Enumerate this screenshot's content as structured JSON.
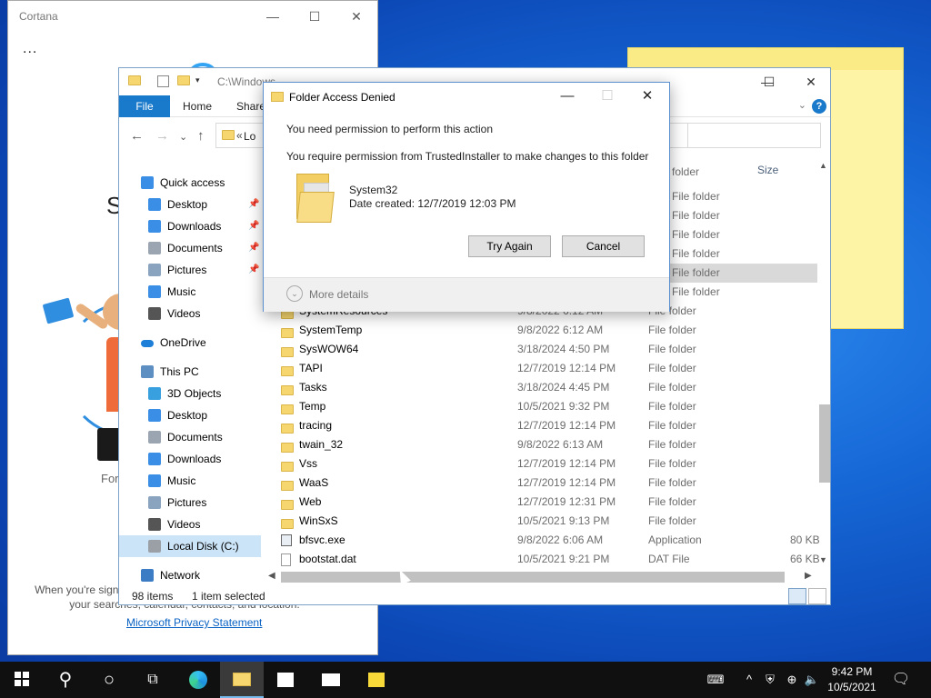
{
  "cortana": {
    "title": "Cortana",
    "ctrl_min": "—",
    "ctrl_max": "☐",
    "ctrl_close": "✕",
    "dots": "...",
    "big_s": "S",
    "for_text": "For",
    "fine_print": "When you're signed in, Cortana can use personal info such as your searches, calendar, contacts, and location.",
    "privacy_link": "Microsoft Privacy Statement"
  },
  "explorer": {
    "path": "C:\\Windows",
    "ctrl_min": "—",
    "ctrl_max": "☐",
    "ctrl_close": "✕",
    "ribbon": {
      "file": "File",
      "home": "Home",
      "share": "Share",
      "help": "?",
      "collapse": "⌄"
    },
    "nav": {
      "back": "←",
      "forward": "→",
      "recent": "⌄",
      "up": "↑"
    },
    "address": {
      "chevron": "«",
      "text": "Lo"
    },
    "nav_pane": [
      {
        "label": "Quick access",
        "icon": "star-icon",
        "level": 0
      },
      {
        "label": "Desktop",
        "icon": "desktop-icon",
        "level": 1,
        "pinned": true
      },
      {
        "label": "Downloads",
        "icon": "downloads-icon",
        "level": 1,
        "pinned": true
      },
      {
        "label": "Documents",
        "icon": "documents-icon",
        "level": 1,
        "pinned": true
      },
      {
        "label": "Pictures",
        "icon": "pictures-icon",
        "level": 1,
        "pinned": true
      },
      {
        "label": "Music",
        "icon": "music-icon",
        "level": 1
      },
      {
        "label": "Videos",
        "icon": "videos-icon",
        "level": 1
      },
      {
        "label": "OneDrive",
        "icon": "cloud-icon",
        "level": 0
      },
      {
        "label": "This PC",
        "icon": "pc-icon",
        "level": 0
      },
      {
        "label": "3D Objects",
        "icon": "cube-icon",
        "level": 1
      },
      {
        "label": "Desktop",
        "icon": "desktop-icon",
        "level": 1
      },
      {
        "label": "Documents",
        "icon": "documents-icon",
        "level": 1
      },
      {
        "label": "Downloads",
        "icon": "downloads-icon",
        "level": 1
      },
      {
        "label": "Music",
        "icon": "music-icon",
        "level": 1
      },
      {
        "label": "Pictures",
        "icon": "pictures-icon",
        "level": 1
      },
      {
        "label": "Videos",
        "icon": "videos-icon",
        "level": 1
      },
      {
        "label": "Local Disk (C:)",
        "icon": "drive-icon",
        "level": 1,
        "selected": true
      },
      {
        "label": "Network",
        "icon": "network-icon",
        "level": 0
      }
    ],
    "pin_glyph": "📌",
    "columns": {
      "size": "Size"
    },
    "partial_rows": [
      {
        "type": "older"
      },
      {
        "type": "older"
      },
      {
        "type": "older"
      },
      {
        "type": "older"
      },
      {
        "type": "older"
      },
      {
        "type": "older"
      },
      {
        "type": "older"
      }
    ],
    "partial_type_text": "File folder",
    "partial_first_type": "folder",
    "rows": [
      {
        "name": "SystemResources",
        "date": "9/8/2022 6:12 AM",
        "type": "File folder",
        "size": "",
        "kind": "folder"
      },
      {
        "name": "SystemTemp",
        "date": "9/8/2022 6:12 AM",
        "type": "File folder",
        "size": "",
        "kind": "folder"
      },
      {
        "name": "SysWOW64",
        "date": "3/18/2024 4:50 PM",
        "type": "File folder",
        "size": "",
        "kind": "folder"
      },
      {
        "name": "TAPI",
        "date": "12/7/2019 12:14 PM",
        "type": "File folder",
        "size": "",
        "kind": "folder"
      },
      {
        "name": "Tasks",
        "date": "3/18/2024 4:45 PM",
        "type": "File folder",
        "size": "",
        "kind": "folder"
      },
      {
        "name": "Temp",
        "date": "10/5/2021 9:32 PM",
        "type": "File folder",
        "size": "",
        "kind": "folder"
      },
      {
        "name": "tracing",
        "date": "12/7/2019 12:14 PM",
        "type": "File folder",
        "size": "",
        "kind": "folder"
      },
      {
        "name": "twain_32",
        "date": "9/8/2022 6:13 AM",
        "type": "File folder",
        "size": "",
        "kind": "folder"
      },
      {
        "name": "Vss",
        "date": "12/7/2019 12:14 PM",
        "type": "File folder",
        "size": "",
        "kind": "folder"
      },
      {
        "name": "WaaS",
        "date": "12/7/2019 12:14 PM",
        "type": "File folder",
        "size": "",
        "kind": "folder"
      },
      {
        "name": "Web",
        "date": "12/7/2019 12:31 PM",
        "type": "File folder",
        "size": "",
        "kind": "folder"
      },
      {
        "name": "WinSxS",
        "date": "10/5/2021 9:13 PM",
        "type": "File folder",
        "size": "",
        "kind": "folder"
      },
      {
        "name": "bfsvc.exe",
        "date": "9/8/2022 6:06 AM",
        "type": "Application",
        "size": "80 KB",
        "kind": "exe"
      },
      {
        "name": "bootstat.dat",
        "date": "10/5/2021 9:21 PM",
        "type": "DAT File",
        "size": "66 KB",
        "kind": "dat"
      }
    ],
    "status": {
      "items": "98 items",
      "selected": "1 item selected"
    },
    "scroll": {
      "up": "▲",
      "down": "▼",
      "left": "◀",
      "right": "▶"
    }
  },
  "dialog": {
    "title": "Folder Access Denied",
    "ctrl_min": "—",
    "ctrl_max": "☐",
    "ctrl_close": "✕",
    "message1": "You need permission to perform this action",
    "message2": "You require permission from TrustedInstaller to make changes to this folder",
    "folder_name": "System32",
    "date_created": "Date created: 12/7/2019 12:03 PM",
    "try_again": "Try Again",
    "cancel": "Cancel",
    "more_icon": "⌄",
    "more_details": "More details"
  },
  "taskbar": {
    "search": "⚲",
    "cortana": "○",
    "taskview": "⧉",
    "clock_time": "9:42 PM",
    "clock_date": "10/5/2021",
    "tray_chevron": "^",
    "notifications": "🗨"
  },
  "colors": {
    "accent": "#1979ca",
    "selection": "#cce4f7",
    "desktop": "#1667d6",
    "sticky": "#fdf4a5"
  }
}
